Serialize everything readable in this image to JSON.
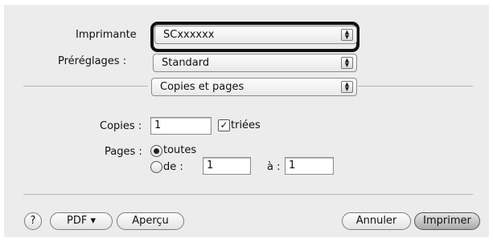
{
  "printer": {
    "label": "Imprimante",
    "value": "SCxxxxxx"
  },
  "presets": {
    "label": "Préréglages :",
    "value": "Standard"
  },
  "section": {
    "value": "Copies et pages"
  },
  "copies": {
    "label": "Copies :",
    "value": "1",
    "collate_label": "triées",
    "collate_checked": true
  },
  "pages": {
    "label": "Pages :",
    "all_label": "toutes",
    "from_label": "de :",
    "from_value": "1",
    "to_label": "à :",
    "to_value": "1",
    "selected": "all"
  },
  "footer": {
    "help_label": "?",
    "pdf_label": "PDF ▾",
    "preview_label": "Aperçu",
    "cancel_label": "Annuler",
    "print_label": "Imprimer"
  },
  "icons": {
    "popup_arrows": "updown-arrows-icon",
    "help": "help-icon",
    "check": "checkmark-icon"
  }
}
